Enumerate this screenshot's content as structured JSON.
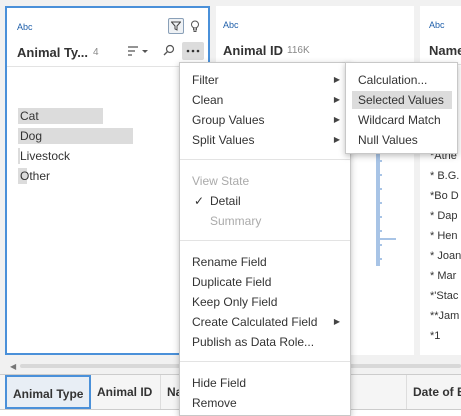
{
  "card1": {
    "type_label": "Abc",
    "field_name": "Animal Ty...",
    "count": "4",
    "bars": [
      {
        "label": "Cat",
        "fraction": 0.74
      },
      {
        "label": "Dog",
        "fraction": 1.0
      },
      {
        "label": "Livestock",
        "fraction": 0.01
      },
      {
        "label": "Other",
        "fraction": 0.08
      }
    ]
  },
  "card2": {
    "type_label": "Abc",
    "field_name": "Animal ID",
    "count": "116K"
  },
  "card3": {
    "type_label": "Abc",
    "field_name": "Name",
    "values": [
      "*Athe",
      "* B.G.",
      "*Bo D",
      "* Dap",
      "* Hen",
      "* Joan",
      "* Mar",
      "*'Stac",
      "**Jam",
      "*1"
    ]
  },
  "grid": {
    "columns": [
      "Animal Type",
      "Animal ID",
      "Na",
      "Date of B"
    ]
  },
  "menu": {
    "items": [
      {
        "label": "Filter",
        "submenu": true
      },
      {
        "label": "Clean",
        "submenu": true
      },
      {
        "label": "Group Values",
        "submenu": true
      },
      {
        "label": "Split Values",
        "submenu": true
      },
      {
        "label": "View State"
      },
      {
        "label": "Detail",
        "checked": true
      },
      {
        "label": "Summary"
      },
      {
        "label": "Rename Field"
      },
      {
        "label": "Duplicate Field"
      },
      {
        "label": "Keep Only Field"
      },
      {
        "label": "Create Calculated Field",
        "submenu": true
      },
      {
        "label": "Publish as Data Role..."
      },
      {
        "label": "Hide Field"
      },
      {
        "label": "Remove"
      }
    ],
    "check_mark": "✓"
  },
  "submenu": {
    "items": [
      "Calculation...",
      "Selected Values",
      "Wildcard Match",
      "Null Values"
    ],
    "highlighted": "Selected Values"
  },
  "icons": {
    "sort": "sort-icon",
    "search": "search-icon",
    "filter": "filter-icon",
    "lightbulb": "lightbulb-icon",
    "more": "more-options-icon"
  }
}
